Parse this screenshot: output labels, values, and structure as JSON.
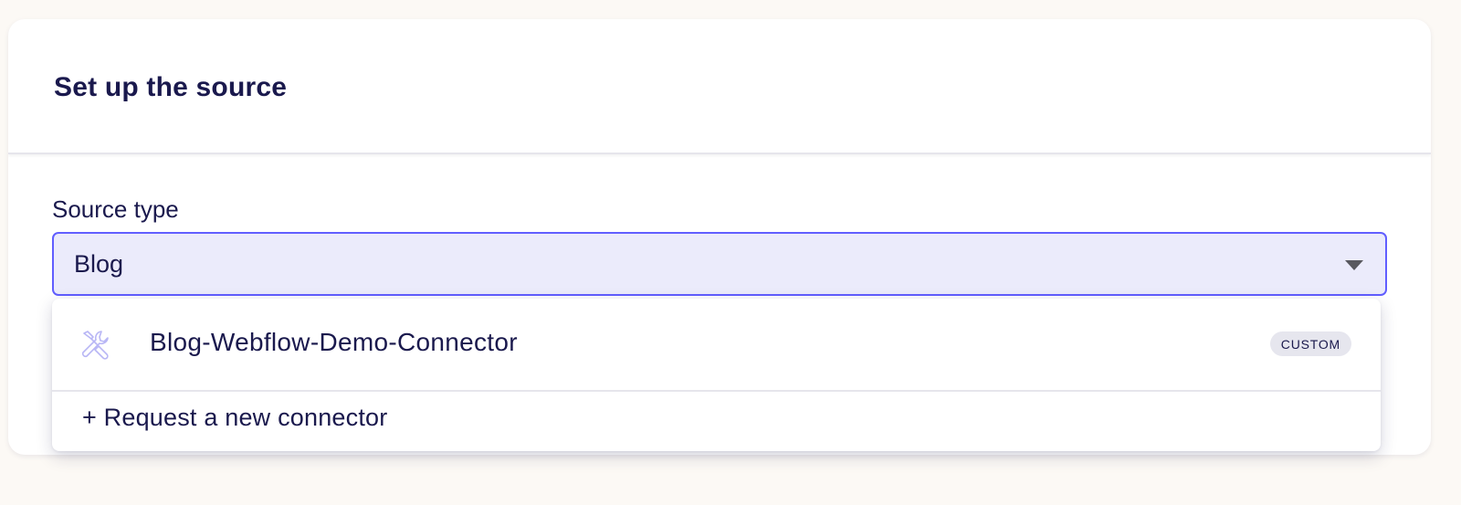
{
  "card": {
    "title": "Set up the source"
  },
  "source_type": {
    "label": "Source type",
    "selected_value": "Blog"
  },
  "dropdown": {
    "options": [
      {
        "icon": "wrench-screwdriver-icon",
        "label": "Blog-Webflow-Demo-Connector",
        "badge": "CUSTOM"
      }
    ],
    "request_link": "+ Request a new connector"
  },
  "colors": {
    "page_background": "#fcf9f5",
    "select_background": "#ebebfb",
    "select_border": "#615eff",
    "text_primary": "#1a194d",
    "badge_background": "#e6e6ee",
    "icon_stroke": "#b8b6f5"
  }
}
